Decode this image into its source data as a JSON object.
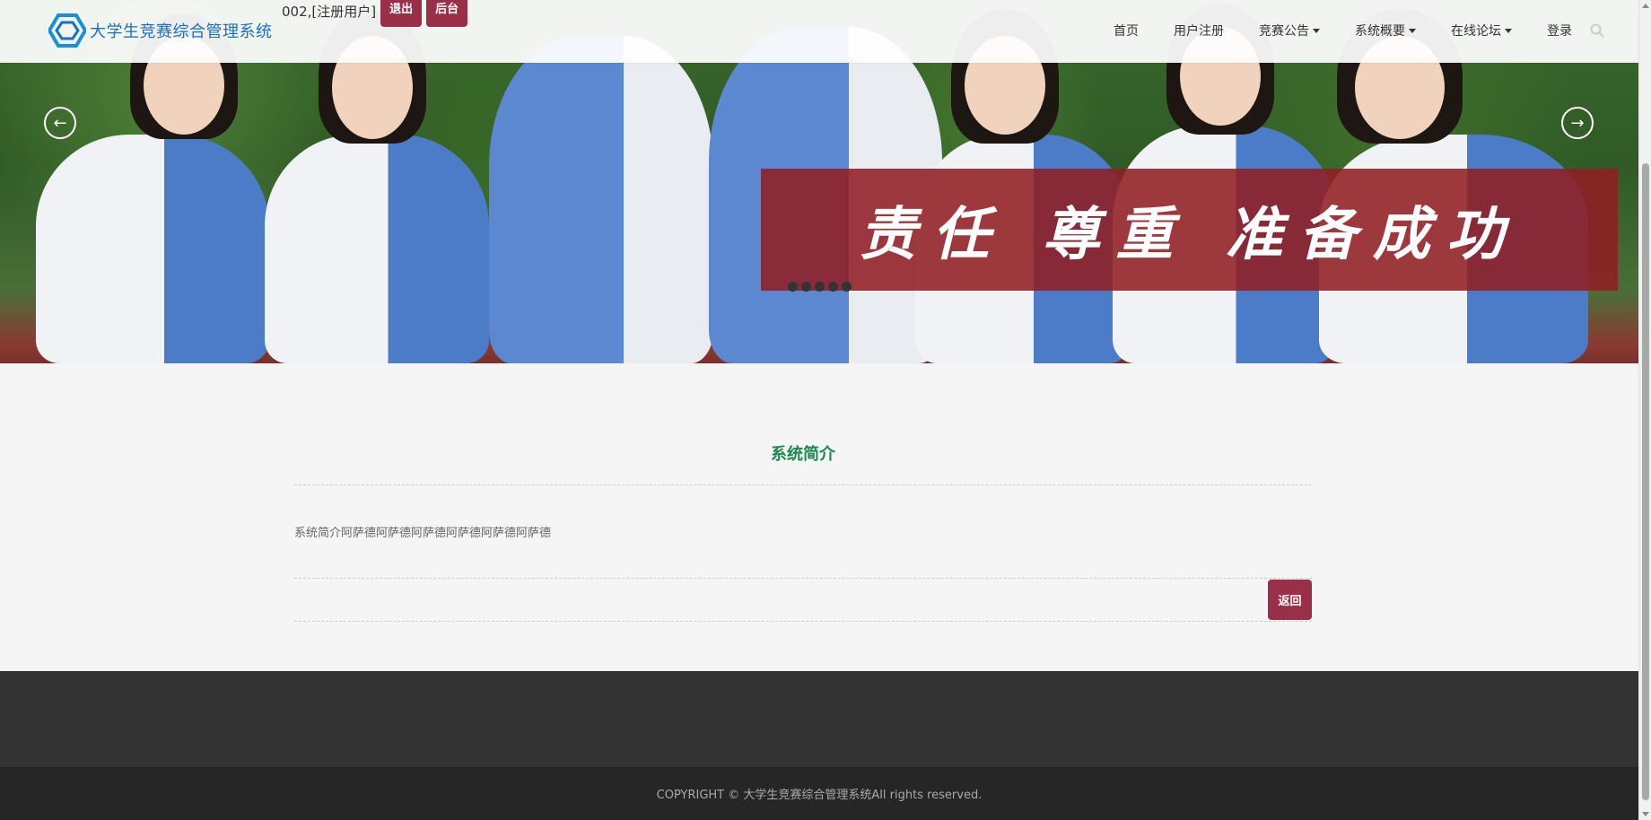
{
  "header": {
    "logo_text": "大学生竞赛综合管理系统",
    "user_label": "002,[注册用户]",
    "logout_label": "退出",
    "admin_label": "后台",
    "nav": [
      {
        "label": "首页",
        "dropdown": false
      },
      {
        "label": "用户注册",
        "dropdown": false
      },
      {
        "label": "竞赛公告",
        "dropdown": true
      },
      {
        "label": "系统概要",
        "dropdown": true
      },
      {
        "label": "在线论坛",
        "dropdown": true
      },
      {
        "label": "登录",
        "dropdown": false
      }
    ],
    "search_icon": "search-icon"
  },
  "banner": {
    "slogan": "责任 尊重 准备成功",
    "slide_count": 5,
    "prev_icon": "arrow-left-icon",
    "next_icon": "arrow-right-icon"
  },
  "main": {
    "title": "系统简介",
    "intro": "系统简介阿萨德阿萨德阿萨德阿萨德阿萨德阿萨德",
    "back_label": "返回"
  },
  "footer": {
    "copyright": "COPYRIGHT © 大学生竞赛综合管理系统All rights reserved."
  },
  "colors": {
    "brand_blue": "#1a6fc4",
    "button_red": "#9a2f4a",
    "title_green": "#1a8a4e",
    "footer_dark": "#333333",
    "footer_darker": "#262626"
  }
}
